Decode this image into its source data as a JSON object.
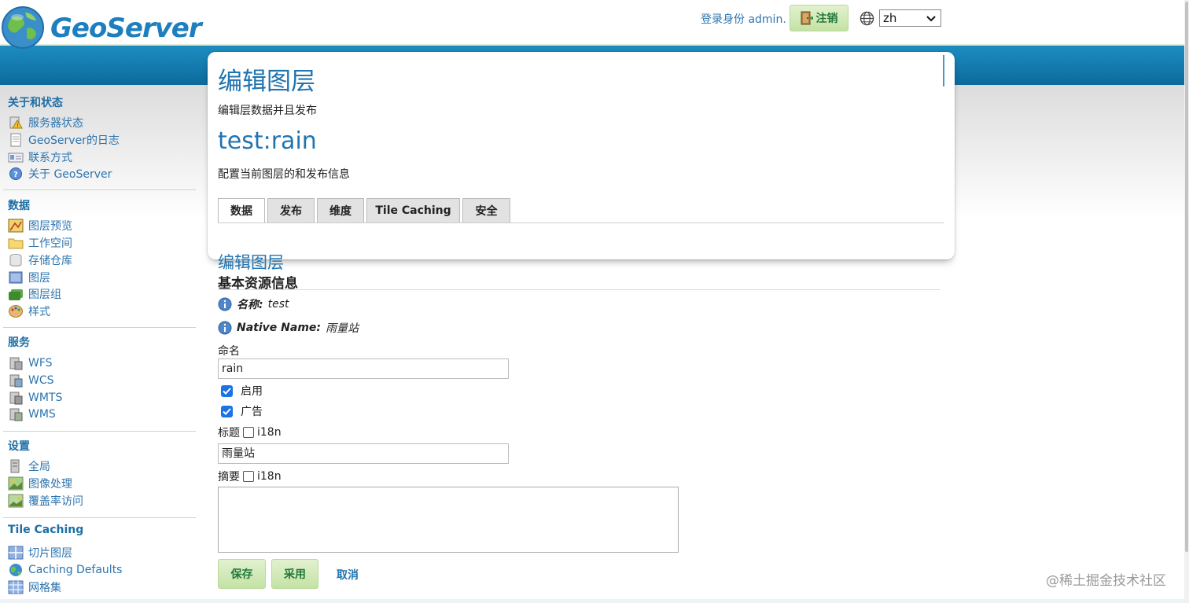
{
  "header": {
    "logo_text": "GeoServer",
    "login_text": "登录身份 admin.",
    "logout_label": "注销",
    "language": "zh"
  },
  "sidebar": {
    "sections": [
      {
        "title": "关于和状态",
        "items": [
          "服务器状态",
          "GeoServer的日志",
          "联系方式",
          "关于 GeoServer"
        ]
      },
      {
        "title": "数据",
        "items": [
          "图层预览",
          "工作空间",
          "存储仓库",
          "图层",
          "图层组",
          "样式"
        ]
      },
      {
        "title": "服务",
        "items": [
          "WFS",
          "WCS",
          "WMTS",
          "WMS"
        ]
      },
      {
        "title": "设置",
        "items": [
          "全局",
          "图像处理",
          "覆盖率访问"
        ]
      },
      {
        "title": "Tile Caching",
        "items": [
          "切片图层",
          "Caching Defaults",
          "网格集"
        ]
      }
    ]
  },
  "main": {
    "page_title": "编辑图层",
    "page_desc": "编辑层数据并且发布",
    "layer_title": "test:rain",
    "layer_desc": "配置当前图层的和发布信息",
    "tabs": [
      "数据",
      "发布",
      "维度",
      "Tile Caching",
      "安全"
    ],
    "active_tab": "数据",
    "section_heading": "编辑图层",
    "section_sub": "基本资源信息",
    "info": [
      {
        "label": "名称:",
        "value": "test"
      },
      {
        "label": "Native Name:",
        "value": "雨量站"
      }
    ],
    "name_label": "命名",
    "name_value": "rain",
    "enabled_label": "启用",
    "enabled": true,
    "advertised_label": "广告",
    "advertised": true,
    "title_label": "标题",
    "title_i18n": "i18n",
    "title_value": "雨量站",
    "abstract_label": "摘要",
    "abstract_i18n": "i18n",
    "abstract_value": ""
  },
  "footer": {
    "save_label": "保存",
    "apply_label": "采用",
    "cancel_label": "取消"
  },
  "watermark": "@稀土掘金技术社区",
  "colors": {
    "accent": "#2074b0",
    "header_blue": "#1d8dc0",
    "button_green": "#c4e2a4",
    "checkbox_blue": "#1a73e8"
  }
}
